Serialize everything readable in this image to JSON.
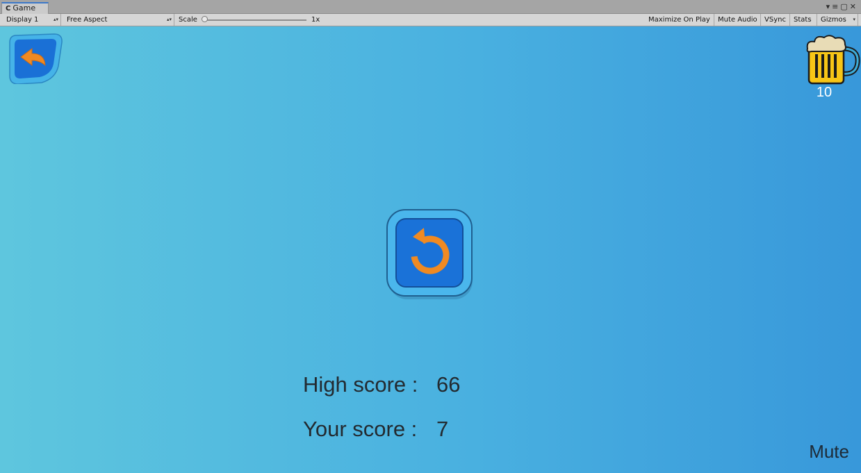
{
  "editor": {
    "tab_title": "Game",
    "display": "Display 1",
    "aspect": "Free Aspect",
    "scale_label": "Scale",
    "scale_value": "1x",
    "maximize_on_play": "Maximize On Play",
    "mute_audio": "Mute Audio",
    "vsync": "VSync",
    "stats": "Stats",
    "gizmos": "Gizmos"
  },
  "game": {
    "beer_count": "10",
    "high_score_label": "High score :",
    "high_score_value": "66",
    "your_score_label": "Your score :",
    "your_score_value": "7",
    "mute_label": "Mute"
  },
  "icons": [
    "unity-icon",
    "back-arrow-icon",
    "beer-mug-icon",
    "restart-icon"
  ],
  "colors": {
    "background_left": "#5ec6de",
    "background_right": "#3898da",
    "button_blue": "#1b6fd4",
    "button_frame": "#4bb3ea",
    "arrow_orange": "#f08a22"
  }
}
